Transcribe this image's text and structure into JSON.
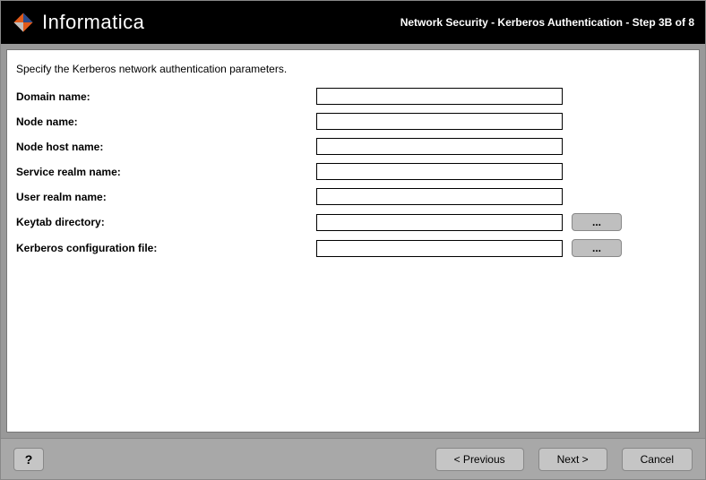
{
  "header": {
    "brand": "Informatica",
    "title": "Network Security - Kerberos Authentication - Step 3B of 8"
  },
  "content": {
    "instruction": "Specify the Kerberos network authentication parameters.",
    "fields": {
      "domain_name": {
        "label": "Domain name:",
        "value": ""
      },
      "node_name": {
        "label": "Node name:",
        "value": ""
      },
      "node_host_name": {
        "label": "Node host name:",
        "value": ""
      },
      "service_realm_name": {
        "label": "Service realm name:",
        "value": ""
      },
      "user_realm_name": {
        "label": "User realm name:",
        "value": ""
      },
      "keytab_directory": {
        "label": "Keytab directory:",
        "value": "",
        "browse": "..."
      },
      "kerberos_config_file": {
        "label": "Kerberos configuration file:",
        "value": "",
        "browse": "..."
      }
    }
  },
  "footer": {
    "help": "?",
    "previous": "< Previous",
    "next": "Next >",
    "cancel": "Cancel"
  }
}
